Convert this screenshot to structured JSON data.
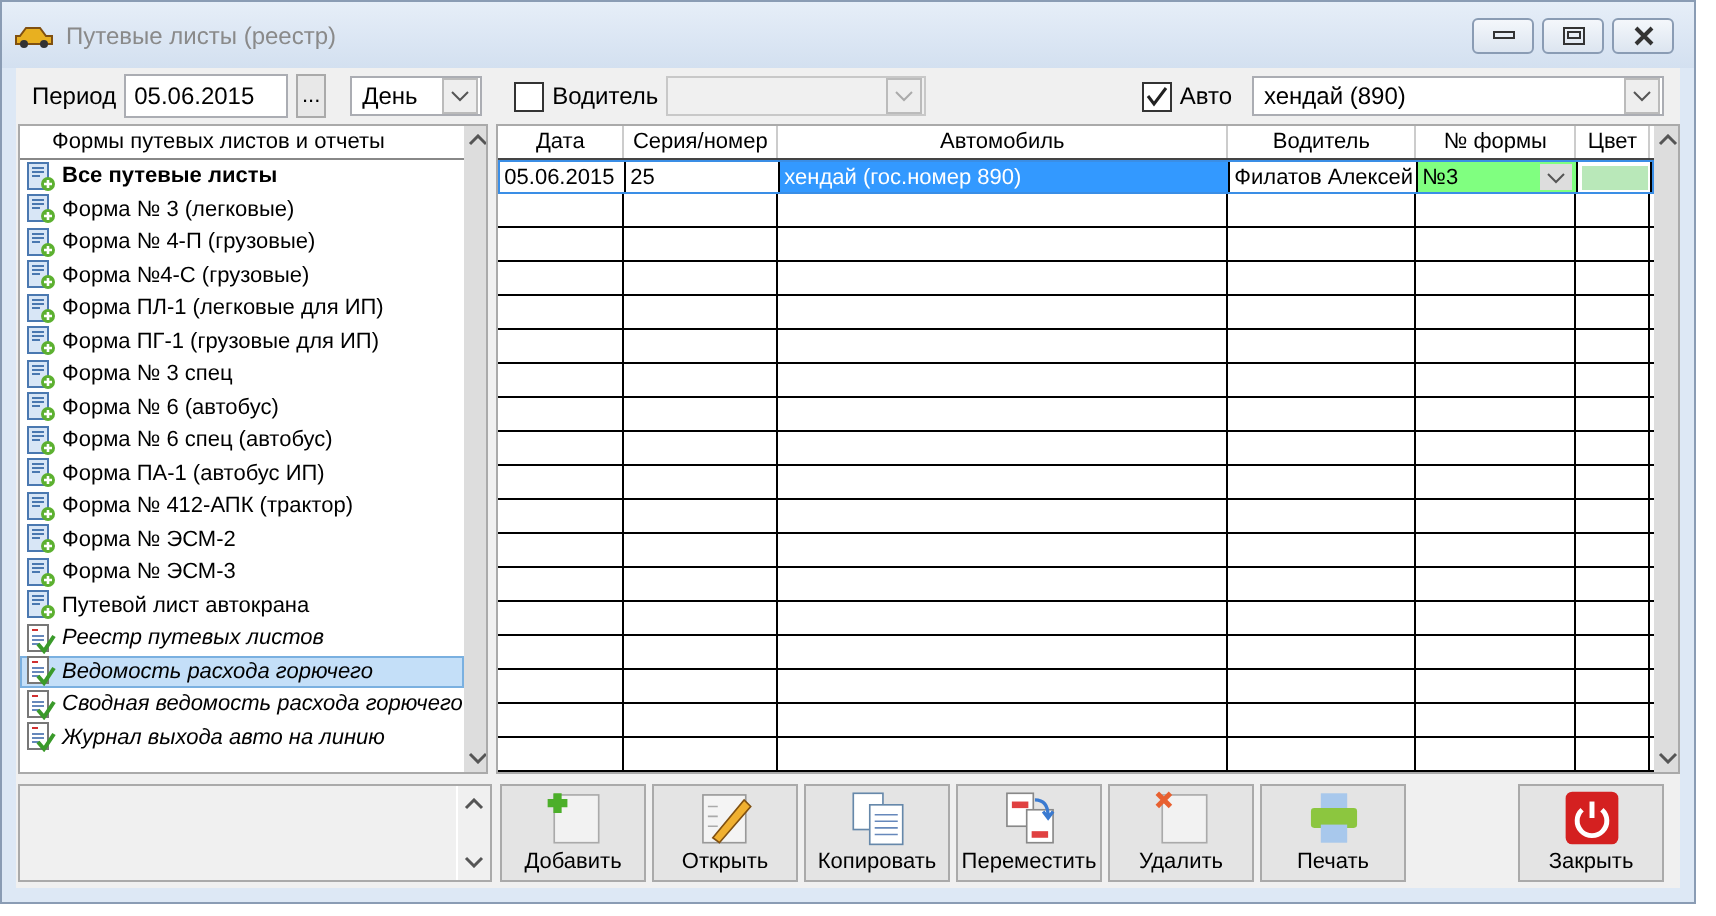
{
  "window": {
    "title": "Путевые листы (реестр)"
  },
  "filter": {
    "period_label": "Период",
    "date": "05.06.2015",
    "picker": "...",
    "period_type": "День",
    "driver": {
      "label": "Водитель",
      "checked": false
    },
    "auto": {
      "label": "Авто",
      "checked": true,
      "value": "хендай (890)"
    }
  },
  "forms": {
    "header": "Формы путевых листов и отчеты",
    "items": [
      {
        "label": "Все путевые листы",
        "kind": "all",
        "selected": false
      },
      {
        "label": "Форма № 3 (легковые)",
        "kind": "form",
        "selected": false
      },
      {
        "label": "Форма № 4-П (грузовые)",
        "kind": "form",
        "selected": false
      },
      {
        "label": "Форма №4-С (грузовые)",
        "kind": "form",
        "selected": false
      },
      {
        "label": "Форма ПЛ-1 (легковые для ИП)",
        "kind": "form",
        "selected": false
      },
      {
        "label": "Форма ПГ-1 (грузовые для ИП)",
        "kind": "form",
        "selected": false
      },
      {
        "label": "Форма № 3 спец",
        "kind": "form",
        "selected": false
      },
      {
        "label": "Форма № 6 (автобус)",
        "kind": "form",
        "selected": false
      },
      {
        "label": "Форма № 6 спец (автобус)",
        "kind": "form",
        "selected": false
      },
      {
        "label": "Форма ПА-1 (автобус ИП)",
        "kind": "form",
        "selected": false
      },
      {
        "label": "Форма № 412-АПК (трактор)",
        "kind": "form",
        "selected": false
      },
      {
        "label": "Форма № ЭСМ-2",
        "kind": "form",
        "selected": false
      },
      {
        "label": "Форма № ЭСМ-3",
        "kind": "form",
        "selected": false
      },
      {
        "label": "Путевой лист автокрана",
        "kind": "form",
        "selected": false
      },
      {
        "label": "Реестр путевых листов",
        "kind": "report",
        "selected": false
      },
      {
        "label": "Ведомость расхода горючего",
        "kind": "report",
        "selected": true
      },
      {
        "label": "Сводная ведомость расхода горючего",
        "kind": "report",
        "selected": false
      },
      {
        "label": "Журнал выхода авто на линию",
        "kind": "report",
        "selected": false
      }
    ]
  },
  "table": {
    "columns": [
      "Дата",
      "Серия/номер",
      "Автомобиль",
      "Водитель",
      "№ формы",
      "Цвет"
    ],
    "rows": [
      {
        "date": "05.06.2015",
        "number": "25",
        "car": "хендай (гос.номер 890)",
        "driver": "Филатов Алексей",
        "form": "№3",
        "color": "#b9e8b9",
        "selected": true
      }
    ]
  },
  "buttons": [
    {
      "label": "Добавить",
      "kind": "add"
    },
    {
      "label": "Открыть",
      "kind": "open"
    },
    {
      "label": "Копировать",
      "kind": "copy"
    },
    {
      "label": "Переместить",
      "kind": "move"
    },
    {
      "label": "Удалить",
      "kind": "delete"
    },
    {
      "label": "Печать",
      "kind": "print"
    },
    {
      "label": "Закрыть",
      "kind": "close"
    }
  ]
}
